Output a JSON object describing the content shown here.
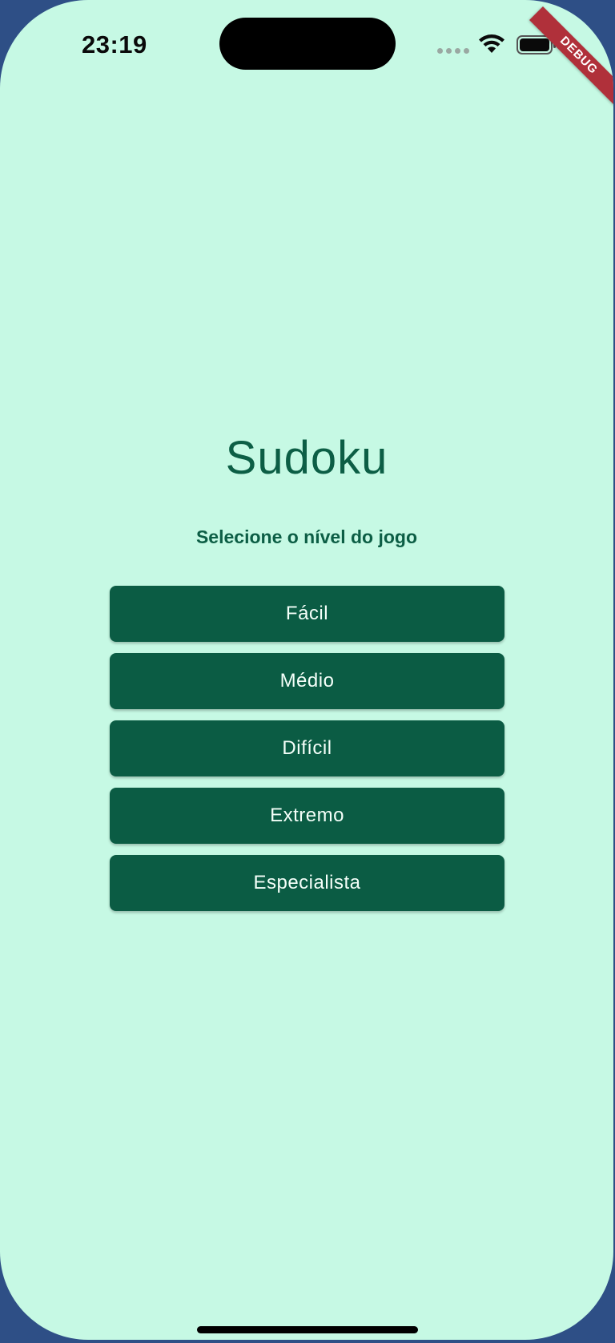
{
  "status_bar": {
    "time": "23:19"
  },
  "debug_banner": "DEBUG",
  "app": {
    "title": "Sudoku",
    "subtitle": "Selecione o nível do jogo",
    "levels": [
      {
        "label": "Fácil"
      },
      {
        "label": "Médio"
      },
      {
        "label": "Difícil"
      },
      {
        "label": "Extremo"
      },
      {
        "label": "Especialista"
      }
    ]
  },
  "colors": {
    "background": "#c6f9e4",
    "primary": "#0b5c44",
    "debug_banner": "#b0303a"
  },
  "icons": [
    "wifi-icon",
    "battery-icon",
    "cellular-signal-icon"
  ]
}
